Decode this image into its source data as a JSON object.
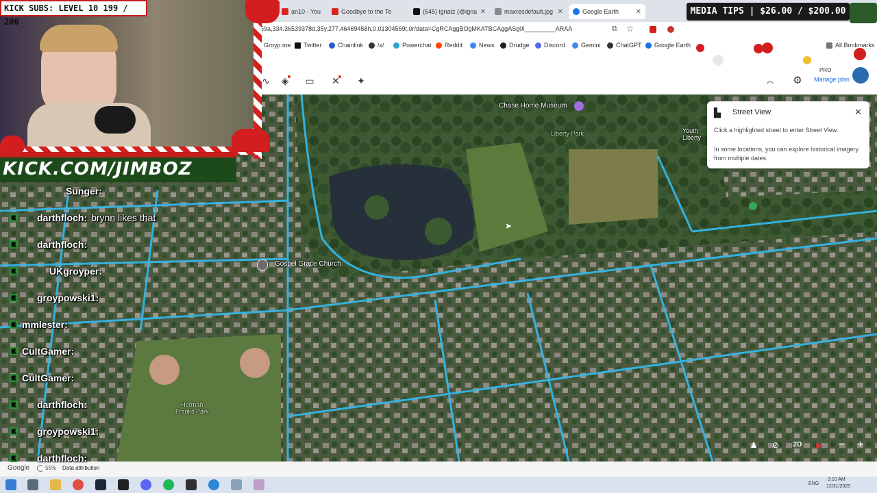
{
  "browser": {
    "tabs": [
      {
        "label": "an10 - You",
        "active": false,
        "color": "#e02424"
      },
      {
        "label": "Goodbye to the Te",
        "active": false,
        "color": "#e02424"
      },
      {
        "label": "(545) ignatz (@igna",
        "active": false,
        "color": "#111111"
      },
      {
        "label": "maxresdefault.jpg",
        "active": false,
        "color": "#6b6b6b"
      },
      {
        "label": "Google Earth",
        "active": true,
        "color": "#1a73e8"
      }
    ],
    "url": "59a,334.36539378d,35y,277.46469458h,0.01304569t,0r/data=CgRCAggBOgMKATBCAggASg0I_________ARAA",
    "bookmarks": [
      "Groyp.me",
      "Twitter",
      "Chainlink",
      "/x/",
      "Powerchat",
      "Reddit",
      "News",
      "Drudge",
      "Discord",
      "Gemini",
      "ChatGPT",
      "Google Earth"
    ],
    "all_bookmarks": "All Bookmarks"
  },
  "earth_toolbar": {
    "plan_tier": "PRO",
    "manage_plan": "Manage plan"
  },
  "map": {
    "labels": {
      "chase_home_museum": "Chase Home Museum",
      "liberty_park": "Liberty Park",
      "youth_liberty": "Youth\nLiberty",
      "gospel_grace_church": "Gospel Grace Church",
      "herman_franks_park": "Herman\nFranks Park",
      "google": "Google",
      "zoom_pct": "55%",
      "data_attribution": "Data attribution"
    },
    "controls": {
      "view_mode": "2D"
    }
  },
  "street_view_panel": {
    "title": "Street View",
    "line1": "Click a highlighted street to enter Street View.",
    "line2": "In some locations, you can explore historical imagery from multiple dates."
  },
  "overlay": {
    "kick_subs": "KICK SUBS: LEVEL 10 199 / 200",
    "kick_url": "KICK.COM/JIMBOZ",
    "media_tips": "MEDIA TIPS | $26.00 / $200.00"
  },
  "chat": [
    {
      "name": "Sunger:",
      "message": "",
      "name_color": "#ffffff"
    },
    {
      "name": "darthfloch:",
      "message": "brynn likes that",
      "name_color": "#ffffff"
    },
    {
      "name": "darthfloch:",
      "message": "",
      "name_color": "#ffffff"
    },
    {
      "name": "UKgroyper:",
      "message": "",
      "name_color": "#ffffff"
    },
    {
      "name": "groypowski1:",
      "message": "",
      "name_color": "#ffffff"
    },
    {
      "name": "mmlester:",
      "message": "",
      "name_color": "#ffffff"
    },
    {
      "name": "CultGamer:",
      "message": "",
      "name_color": "#ffffff"
    },
    {
      "name": "CultGamer:",
      "message": "",
      "name_color": "#ffffff"
    },
    {
      "name": "darthfloch:",
      "message": "",
      "name_color": "#ffffff"
    },
    {
      "name": "groypowski1:",
      "message": "",
      "name_color": "#ffffff"
    },
    {
      "name": "darthfloch:",
      "message": "",
      "name_color": "#ffffff"
    }
  ],
  "taskbar": {
    "time": "3:10 AM",
    "date": "12/31/2025",
    "lang": "ENG"
  }
}
